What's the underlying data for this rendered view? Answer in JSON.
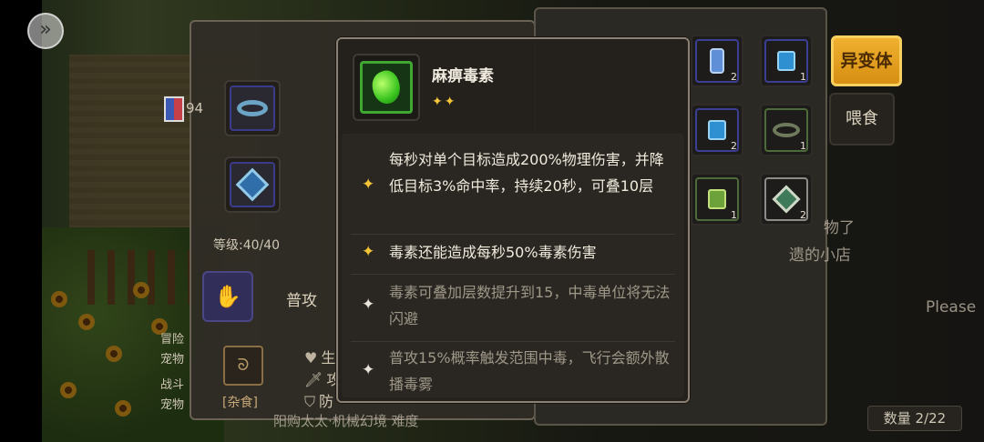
{
  "tooltip": {
    "title": "麻痹毒素",
    "stars": "✦✦",
    "effects": [
      {
        "text": "每秒对单个目标造成200%物理伤害，并降低目标3%命中率，持续20秒，可叠10层",
        "unlocked": true
      },
      {
        "text": "毒素还能造成每秒50%毒素伤害",
        "unlocked": true
      },
      {
        "text": "毒素可叠加层数提升到15，中毒单位将无法闪避",
        "unlocked": false
      },
      {
        "text": "普攻15%概率触发范围中毒，飞行会额外散播毒雾",
        "unlocked": false
      }
    ]
  },
  "pet_panel": {
    "level": "等级:40/40",
    "skill_label": "普攻",
    "food_label": "[杂食]",
    "stats": [
      "生",
      "攻",
      "防"
    ],
    "side_lines": [
      "冒险",
      "宠物",
      "战斗",
      "宠物"
    ],
    "name_fragment": "94",
    "bottom_text": "阳购太太·机械幻境 难度"
  },
  "inventory": {
    "items": [
      {
        "icon": "potion-bottle-icon",
        "count": "2"
      },
      {
        "icon": "blue-lantern-icon",
        "count": "1"
      },
      {
        "icon": "blue-lantern-icon",
        "count": "2"
      },
      {
        "icon": "ring-icon",
        "count": "1"
      },
      {
        "icon": "green-lantern-icon",
        "count": "1"
      },
      {
        "icon": "gem-amulet-icon",
        "count": "2"
      }
    ],
    "mutation_button": "异变体",
    "feed_button": "喂食",
    "count_text": "数量 2/22",
    "bg_text_1": "物了",
    "bg_text_2": "遗的小店",
    "bg_text_3": "Please"
  },
  "colors": {
    "accent_gold": "#f4c437",
    "mutation_button": "#e39e1e",
    "poison_green": "#3ea832"
  }
}
